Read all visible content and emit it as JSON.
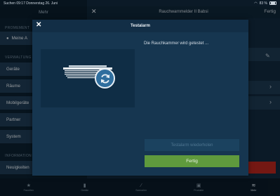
{
  "statusbar": {
    "left": "Suchen  09:17  Donnerstag 26. Juni",
    "right": "83 %"
  },
  "master": {
    "title": "Mehr",
    "section1": "PROMEMENT",
    "account_label": "Meine A",
    "section2": "VERWALTUNG",
    "items": [
      "Geräte",
      "Räume",
      "Mobilgeräte",
      "Partner",
      "System"
    ],
    "section3": "INFORMATION",
    "news_label": "Neuigkeiten"
  },
  "detail": {
    "title": "Rauchwarnmelder II Babsi",
    "done_label": "Fertig"
  },
  "modal": {
    "title": "Testalarm",
    "status_text": "Die Rauchkammer wird getestet ...",
    "disabled_button_label": "Testalarm wiederholen",
    "done_button_label": "Fertig"
  },
  "tabbar": {
    "tabs": [
      {
        "label": "Favoriten",
        "icon": "star-icon"
      },
      {
        "label": "Geräte",
        "icon": "device-icon"
      },
      {
        "label": "Szenarien",
        "icon": "wand-icon"
      },
      {
        "label": "Produkte",
        "icon": "product-icon"
      },
      {
        "label": "Mehr",
        "icon": "stack-icon"
      }
    ]
  },
  "colors": {
    "accent_green": "#5f9a3d",
    "modal_bg": "#163650",
    "spinner": "#2f6e9e",
    "alert_red": "#b3261e"
  }
}
